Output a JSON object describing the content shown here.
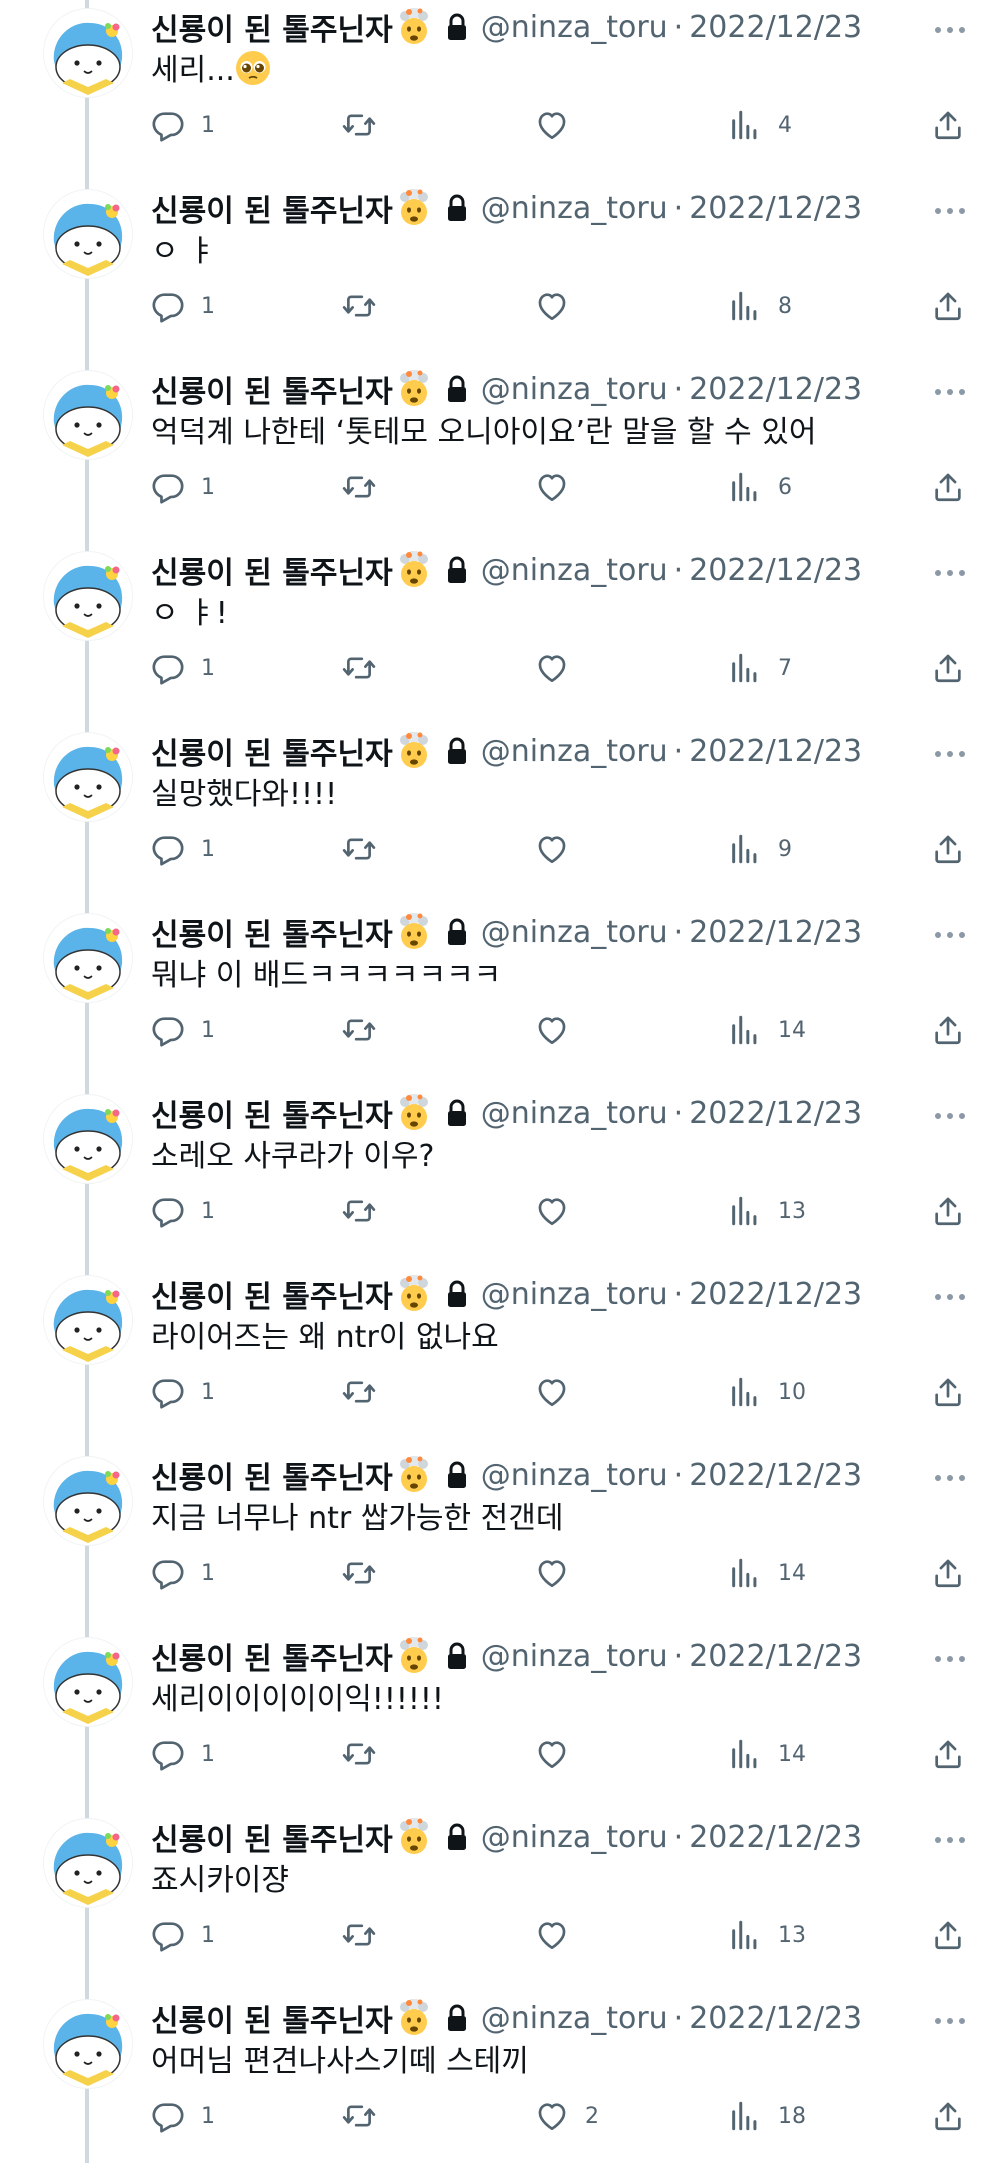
{
  "author": {
    "display_name": "신룡이 된 톨주닌자",
    "handle": "@ninza_toru",
    "separator": "·",
    "name_emoji": "exploding-head-emoji",
    "protected_icon": "lock-icon",
    "avatar": "blue-cartoon-creature-avatar"
  },
  "colors": {
    "text": "#0f1419",
    "secondary": "#536471",
    "thread_line": "#cfd9de",
    "avatar_blue": "#5ab4ea"
  },
  "icons": {
    "reply": "speech-bubble-icon",
    "retweet": "retweet-arrows-icon",
    "like": "heart-icon",
    "views": "bar-chart-icon",
    "share": "share-upload-icon",
    "more": "three-dots-icon"
  },
  "tweets": [
    {
      "date": "2022/12/23",
      "text": "세리...",
      "emoji_after_text": "pleading-face-emoji",
      "replies": "1",
      "retweets": "",
      "likes": "",
      "views": "4"
    },
    {
      "date": "2022/12/23",
      "text": "ㅇ ㅑ",
      "replies": "1",
      "retweets": "",
      "likes": "",
      "views": "8"
    },
    {
      "date": "2022/12/23",
      "text": "억덕계 나한테 ‘톳테모 오니아이요’란 말을 할 수 있어",
      "replies": "1",
      "retweets": "",
      "likes": "",
      "views": "6"
    },
    {
      "date": "2022/12/23",
      "text": "ㅇ ㅑ!",
      "replies": "1",
      "retweets": "",
      "likes": "",
      "views": "7"
    },
    {
      "date": "2022/12/23",
      "text": "실망했다와!!!!",
      "replies": "1",
      "retweets": "",
      "likes": "",
      "views": "9"
    },
    {
      "date": "2022/12/23",
      "text": "뭐냐 이 배드ㅋㅋㅋㅋㅋㅋㅋ",
      "replies": "1",
      "retweets": "",
      "likes": "",
      "views": "14"
    },
    {
      "date": "2022/12/23",
      "text": "소레오 사쿠라가 이우?",
      "replies": "1",
      "retweets": "",
      "likes": "",
      "views": "13"
    },
    {
      "date": "2022/12/23",
      "text": "라이어즈는 왜 ntr이 없나요",
      "replies": "1",
      "retweets": "",
      "likes": "",
      "views": "10"
    },
    {
      "date": "2022/12/23",
      "text": "지금 너무나 ntr 쌉가능한 전갠데",
      "replies": "1",
      "retweets": "",
      "likes": "",
      "views": "14"
    },
    {
      "date": "2022/12/23",
      "text": "세리이이이이이익!!!!!!",
      "replies": "1",
      "retweets": "",
      "likes": "",
      "views": "14"
    },
    {
      "date": "2022/12/23",
      "text": "죠시카이쟝",
      "replies": "1",
      "retweets": "",
      "likes": "",
      "views": "13"
    },
    {
      "date": "2022/12/23",
      "text": "어머님 편견나사스기떼 스테끼",
      "replies": "1",
      "retweets": "",
      "likes": "2",
      "views": "18"
    }
  ]
}
